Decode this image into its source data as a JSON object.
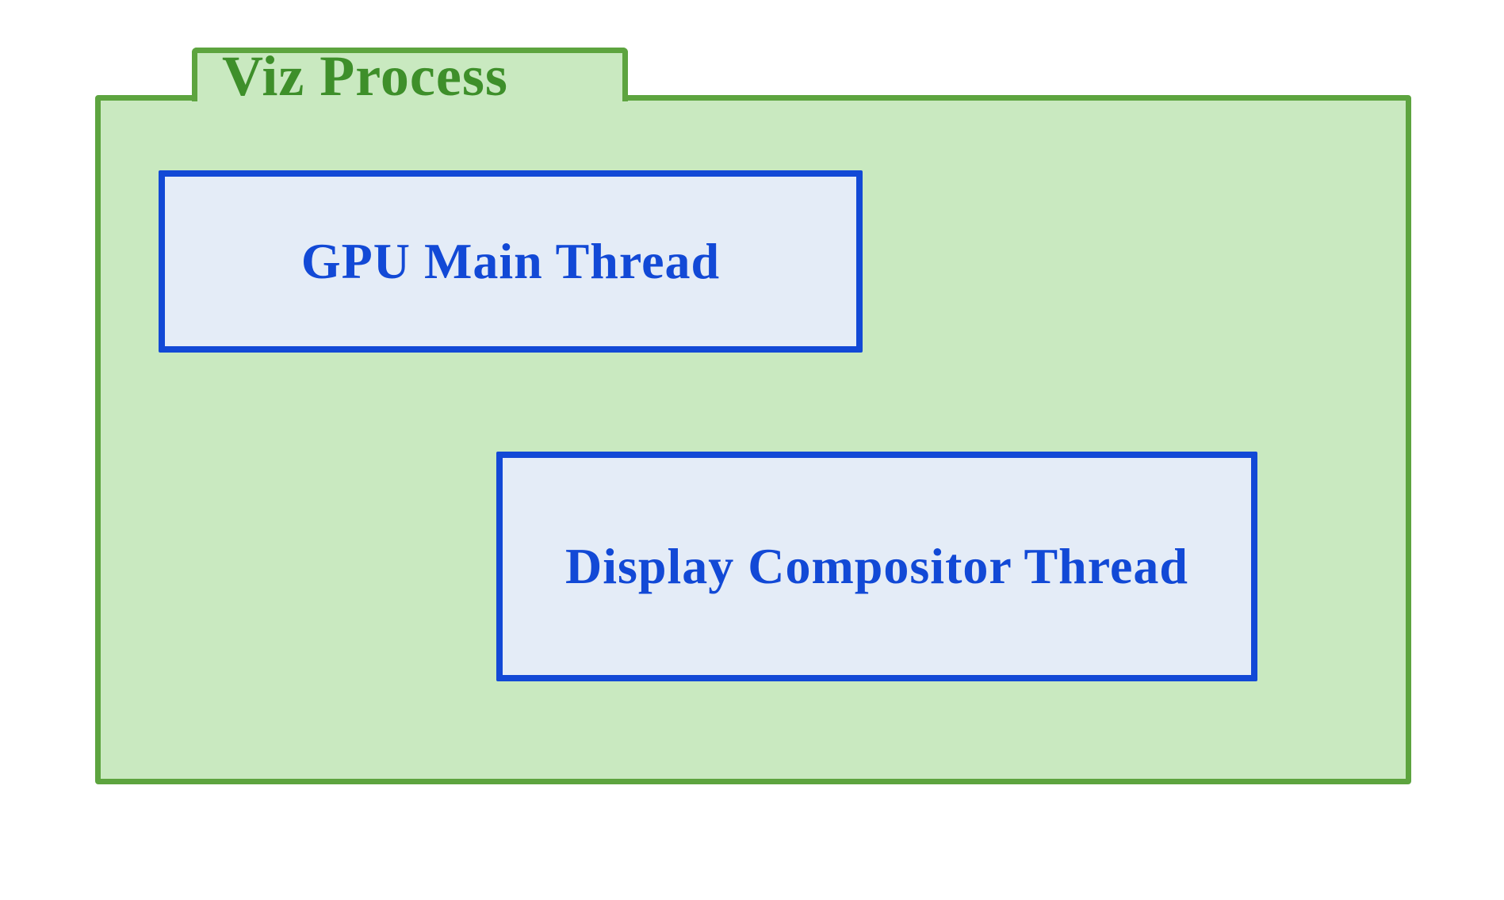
{
  "diagram": {
    "title": "Viz Process",
    "threads": [
      {
        "label": "GPU Main Thread"
      },
      {
        "label": "Display Compositor Thread"
      }
    ],
    "colors": {
      "container_border": "#5da43f",
      "container_fill": "#c9e9c0",
      "box_border": "#1249d6",
      "box_fill": "#e4ecf7",
      "title_text": "#3e8f2a",
      "box_text": "#1249d6"
    }
  }
}
